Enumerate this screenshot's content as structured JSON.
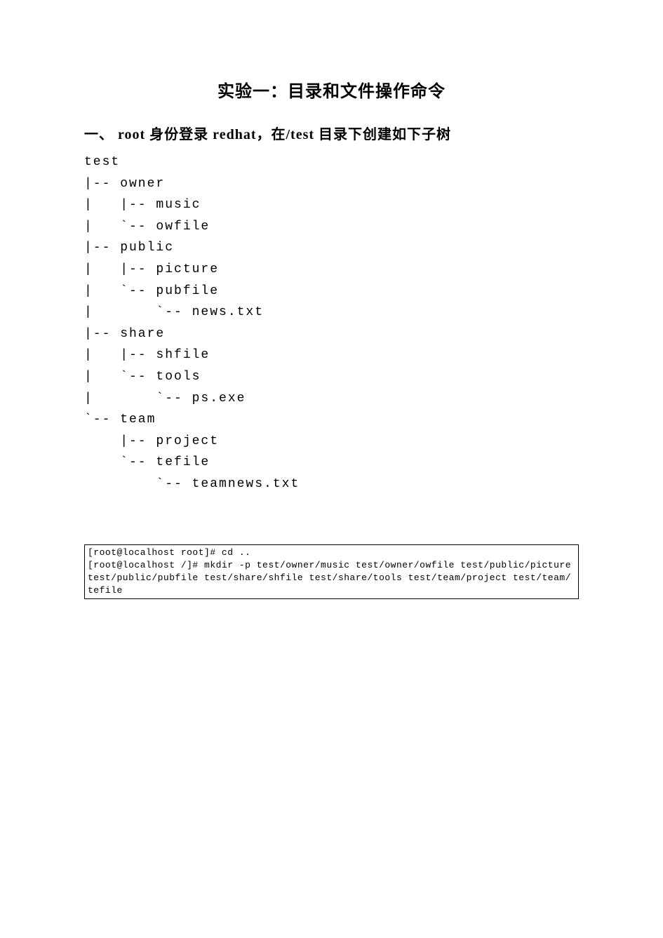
{
  "title": "实验一：目录和文件操作命令",
  "subtitle": "一、 root 身份登录 redhat，在/test 目录下创建如下子树",
  "tree": "test\n|-- owner\n|   |-- music\n|   `-- owfile\n|-- public\n|   |-- picture\n|   `-- pubfile\n|       `-- news.txt\n|-- share\n|   |-- shfile\n|   `-- tools\n|       `-- ps.exe\n`-- team\n    |-- project\n    `-- tefile\n        `-- teamnews.txt",
  "terminal": {
    "line1": "[root@localhost root]# cd ..",
    "line2": "[root@localhost /]# mkdir -p test/owner/music test/owner/owfile test/public/picture test/public/pubfile test/share/shfile test/share/tools test/team/project test/team/tefile"
  }
}
